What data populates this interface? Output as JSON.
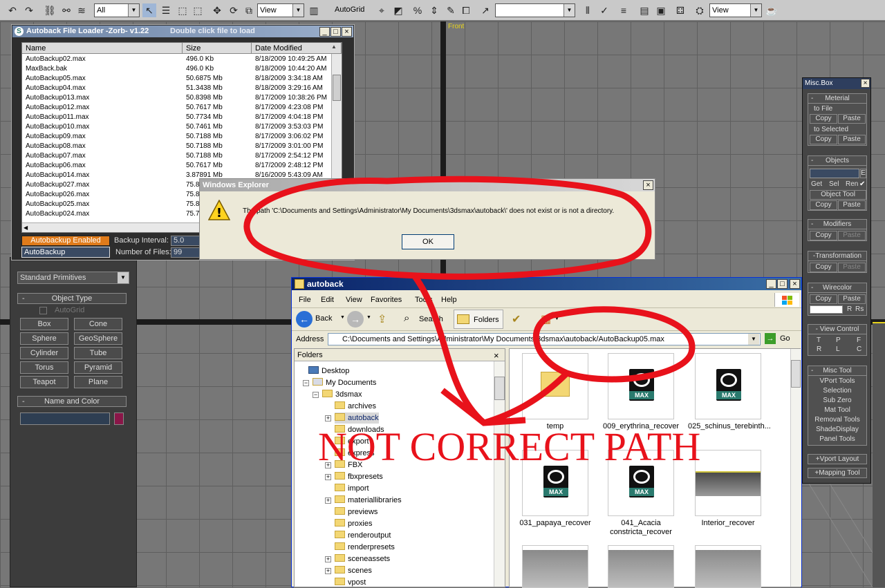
{
  "toolbar": {
    "selection_filter": "All",
    "ref_coord": "View",
    "autogrid": "AutoGrid",
    "named_sel": "",
    "view_dropdown": "View"
  },
  "viewports": {
    "front_label": "Front"
  },
  "loader": {
    "title": "Autoback File Loader -Zorb- v1.22",
    "hint": "Double click file to load",
    "columns": [
      "Name",
      "Size",
      "Date Modified"
    ],
    "rows": [
      [
        "AutoBackup02.max",
        "496.0 Kb",
        "8/18/2009 10:49:25 AM"
      ],
      [
        "MaxBack.bak",
        "496.0 Kb",
        "8/18/2009 10:44:20 AM"
      ],
      [
        "AutoBackup05.max",
        "50.6875 Mb",
        "8/18/2009 3:34:18 AM"
      ],
      [
        "AutoBackup04.max",
        "51.3438 Mb",
        "8/18/2009 3:29:16 AM"
      ],
      [
        "AutoBackup013.max",
        "50.8398 Mb",
        "8/17/2009 10:38:26 PM"
      ],
      [
        "AutoBackup012.max",
        "50.7617 Mb",
        "8/17/2009 4:23:08 PM"
      ],
      [
        "AutoBackup011.max",
        "50.7734 Mb",
        "8/17/2009 4:04:18 PM"
      ],
      [
        "AutoBackup010.max",
        "50.7461 Mb",
        "8/17/2009 3:53:03 PM"
      ],
      [
        "AutoBackup09.max",
        "50.7188 Mb",
        "8/17/2009 3:06:02 PM"
      ],
      [
        "AutoBackup08.max",
        "50.7188 Mb",
        "8/17/2009 3:01:00 PM"
      ],
      [
        "AutoBackup07.max",
        "50.7188 Mb",
        "8/17/2009 2:54:12 PM"
      ],
      [
        "AutoBackup06.max",
        "50.7617 Mb",
        "8/17/2009 2:48:12 PM"
      ],
      [
        "AutoBackup014.max",
        "3.87891 Mb",
        "8/16/2009 5:43:09 AM"
      ],
      [
        "AutoBackup027.max",
        "75.8",
        ""
      ],
      [
        "AutoBackup026.max",
        "75.8",
        ""
      ],
      [
        "AutoBackup025.max",
        "75.8",
        ""
      ],
      [
        "AutoBackup024.max",
        "75.7",
        ""
      ]
    ],
    "autobackup_enabled": "Autobackup Enabled",
    "backup_interval_label": "Backup Interval:",
    "backup_interval": "5.0",
    "autobackup_name": "AutoBackup",
    "num_files_label": "Number of Files:",
    "num_files": "99"
  },
  "cmdpanel": {
    "category": "Standard Primitives",
    "object_type": "Object Type",
    "autogrid": "AutoGrid",
    "buttons": [
      "Box",
      "Cone",
      "Sphere",
      "GeoSphere",
      "Cylinder",
      "Tube",
      "Torus",
      "Pyramid",
      "Teapot",
      "Plane"
    ],
    "name_color": "Name and Color",
    "minus": "-"
  },
  "miscbox": {
    "title": "Misc.Box",
    "meterial": "Meterial",
    "to_file": "to File",
    "copy": "Copy",
    "paste": "Paste",
    "to_selected": "to Selected",
    "objects": "Objects",
    "e": "E",
    "get": "Get",
    "sel": "Sel",
    "ren": "Ren",
    "object_tool": "Object Tool",
    "modifiers": "Modifiers",
    "transformation": "Transformation",
    "wirecolor": "Wirecolor",
    "r": "R",
    "rs": "Rs",
    "view_control": "View Control",
    "t": "T",
    "p": "P",
    "f": "F",
    "rr": "R",
    "l": "L",
    "c": "C",
    "misc_tool": "Misc Tool",
    "misc_items": [
      "VPort Tools",
      "Selection",
      "Sub Zero",
      "Mat Tool",
      "Removal Tools",
      "ShadeDisplay",
      "Panel Tools"
    ],
    "vport_layout": "Vport Layout",
    "mapping_tool": "Mapping Tool",
    "plus": "+",
    "minus": "-"
  },
  "dialog": {
    "title": "Windows Explorer",
    "message": "The path 'C:\\Documents and Settings\\Administrator\\My Documents\\3dsmax\\autoback\\' does not exist or is not a directory.",
    "ok": "OK",
    "close": "×"
  },
  "explorer": {
    "title": "autoback",
    "menu": [
      "File",
      "Edit",
      "View",
      "Favorites",
      "Tools",
      "Help"
    ],
    "back": "Back",
    "search": "Search",
    "folders": "Folders",
    "address_label": "Address",
    "address": "C:\\Documents and Settings\\Administrator\\My Documents\\3dsmax\\autoback/AutoBackup05.max",
    "go": "Go",
    "folders_pane": "Folders",
    "close": "×",
    "tree": [
      {
        "label": "Desktop"
      },
      {
        "label": "My Documents"
      },
      {
        "label": "3dsmax"
      },
      {
        "label": "archives"
      },
      {
        "label": "autoback"
      },
      {
        "label": "downloads"
      },
      {
        "label": "export"
      },
      {
        "label": "express"
      },
      {
        "label": "FBX"
      },
      {
        "label": "fbxpresets"
      },
      {
        "label": "import"
      },
      {
        "label": "materiallibraries"
      },
      {
        "label": "previews"
      },
      {
        "label": "proxies"
      },
      {
        "label": "renderoutput"
      },
      {
        "label": "renderpresets"
      },
      {
        "label": "sceneassets"
      },
      {
        "label": "scenes"
      },
      {
        "label": "vpost"
      }
    ],
    "files": [
      {
        "label": "temp"
      },
      {
        "label": "009_erythrina_recover"
      },
      {
        "label": "025_schinus_terebinth..."
      },
      {
        "label": "031_papaya_recover"
      },
      {
        "label": "041_Acacia constricta_recover"
      },
      {
        "label": "Interior_recover"
      }
    ],
    "max_badge": "MAX"
  },
  "annotation": {
    "text": "NOT CORRECT PATH",
    "color": "#e8121b"
  }
}
